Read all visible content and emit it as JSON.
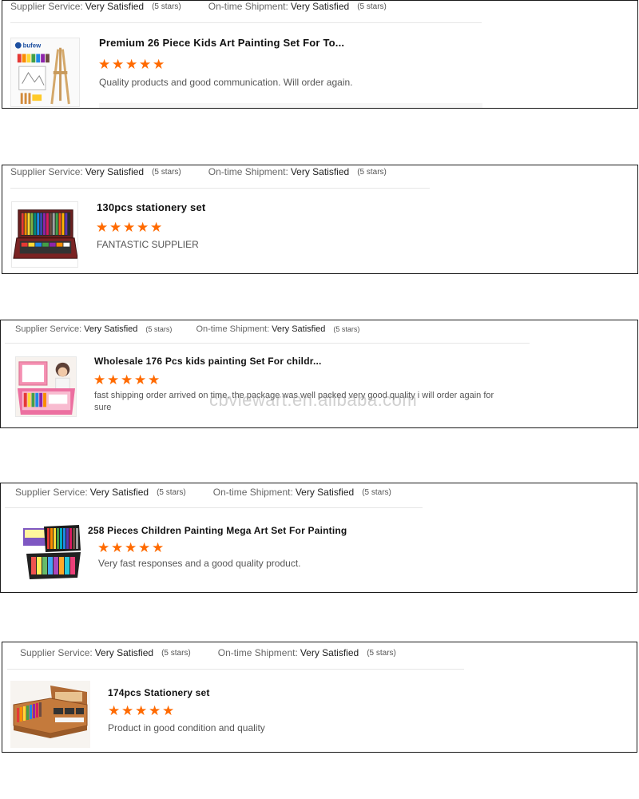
{
  "labels": {
    "supplier_service": "Supplier Service:",
    "ontime_shipment": "On-time Shipment:"
  },
  "reviews": [
    {
      "supplier_value": "Very Satisfied",
      "supplier_stars": "(5 stars)",
      "shipment_value": "Very Satisfied",
      "shipment_stars": "(5 stars)",
      "product_title": "Premium 26 Piece Kids Art Painting Set For To...",
      "rating": 5,
      "review_text": "Quality products and good communication. Will order again.",
      "thumb_brand_text": "bufew"
    },
    {
      "supplier_value": "Very Satisfied",
      "supplier_stars": "(5 stars)",
      "shipment_value": "Very Satisfied",
      "shipment_stars": "(5 stars)",
      "product_title": "130pcs stationery set",
      "rating": 5,
      "review_text": "FANTASTIC SUPPLIER"
    },
    {
      "supplier_value": "Very Satisfied",
      "supplier_stars": "(5 stars)",
      "shipment_value": "Very Satisfied",
      "shipment_stars": "(5 stars)",
      "product_title": "Wholesale 176 Pcs kids painting Set For childr...",
      "rating": 5,
      "review_text": "fast shipping order arrived on time, the package was well packed very good quality i will order again for sure"
    },
    {
      "supplier_value": "Very Satisfied",
      "supplier_stars": "(5 stars)",
      "shipment_value": "Very Satisfied",
      "shipment_stars": "(5 stars)",
      "product_title": "258 Pieces Children Painting Mega Art Set For Painting",
      "rating": 5,
      "review_text": "Very fast responses and a good quality product."
    },
    {
      "supplier_value": "Very Satisfied",
      "supplier_stars": "(5 stars)",
      "shipment_value": "Very Satisfied",
      "shipment_stars": "(5 stars)",
      "product_title": "174pcs Stationery set",
      "rating": 5,
      "review_text": "Product in good condition and quality"
    }
  ],
  "star_glyph": "★",
  "star_color": "#ff6a00",
  "watermark": "cbviewart.en.alibaba.com"
}
